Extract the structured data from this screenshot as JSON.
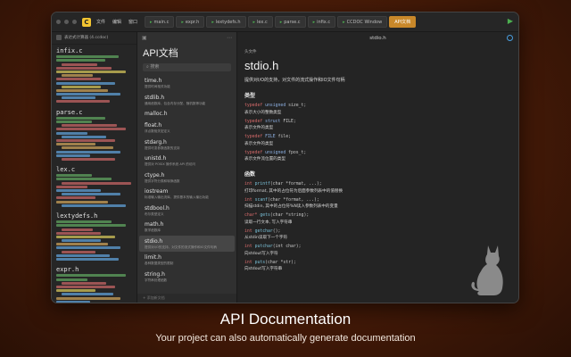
{
  "window": {
    "app_icon": "app-logo",
    "menu": [
      "文件",
      "编辑",
      "窗口",
      "工具"
    ],
    "tabs": [
      {
        "label": "main.c",
        "active": false
      },
      {
        "label": "expr.h",
        "active": false
      },
      {
        "label": "lextydefs.h",
        "active": false
      },
      {
        "label": "lex.c",
        "active": false
      },
      {
        "label": "parse.c",
        "active": false
      },
      {
        "label": "infix.c",
        "active": false
      },
      {
        "label": "CCDOC Window",
        "active": false
      },
      {
        "label": "API文档",
        "active": true
      }
    ]
  },
  "sidebar": {
    "header": "表达式计算器 (4.ccdoc)",
    "files": [
      {
        "name": "infix.c",
        "colors": [
          "#5fa35f",
          "#5fa35f",
          "#c46464",
          "#c46464",
          "#d2c35a",
          "#c9a05a",
          "#c46464",
          "#5f9fd5",
          "#d2c35a",
          "#c9a05a",
          "#5f9fd5",
          "#5f9fd5",
          "#c46464"
        ]
      },
      {
        "name": "parse.c",
        "colors": [
          "#5fa35f",
          "#5fa35f",
          "#c46464",
          "#c46464",
          "#5f9fd5",
          "#5f9fd5",
          "#c46464",
          "#c9a05a",
          "#c9a05a",
          "#5f9fd5",
          "#5f9fd5",
          "#c46464"
        ]
      },
      {
        "name": "lex.c",
        "colors": [
          "#5fa35f",
          "#5fa35f",
          "#c46464",
          "#c46464",
          "#5f9fd5",
          "#5f9fd5",
          "#c46464",
          "#c9a05a",
          "#5f9fd5"
        ]
      },
      {
        "name": "lextydefs.h",
        "colors": [
          "#5fa35f",
          "#5fa35f",
          "#c46464",
          "#c46464",
          "#d2c35a",
          "#5f9fd5",
          "#c9a05a",
          "#5f9fd5",
          "#c46464",
          "#5f9fd5",
          "#5f9fd5"
        ]
      },
      {
        "name": "expr.h",
        "colors": [
          "#5fa35f",
          "#5fa35f",
          "#c46464",
          "#c46464",
          "#d2c35a",
          "#5f9fd5",
          "#c9a05a",
          "#5f9fd5",
          "#5f9fd5",
          "#c46464",
          "#5f9fd5"
        ]
      },
      {
        "name": "main.c",
        "colors": [
          "#5fa35f",
          "#5fa35f",
          "#c46464"
        ]
      }
    ]
  },
  "docnav": {
    "title": "API文档",
    "search_placeholder": "搜索",
    "items": [
      {
        "title": "time.h",
        "desc": "提供时间相关功能",
        "selected": false
      },
      {
        "title": "stdlib.h",
        "desc": "通用函数库，包含内存分配、随机数等功能",
        "selected": false
      },
      {
        "title": "malloc.h",
        "desc": "",
        "selected": false
      },
      {
        "title": "float.h",
        "desc": "浮点数相关宏定义",
        "selected": false
      },
      {
        "title": "stdarg.h",
        "desc": "提供可变参数函数的支持",
        "selected": false
      },
      {
        "title": "unistd.h",
        "desc": "提供对 POSIX 操作系统 API 的访问",
        "selected": false
      },
      {
        "title": "ctype.h",
        "desc": "提供字符分类和转换函数",
        "selected": false
      },
      {
        "title": "iostream",
        "desc": "标准输入输出流库，提供基本的输入输出功能",
        "selected": false
      },
      {
        "title": "stdbool.h",
        "desc": "布尔类型定义",
        "selected": false
      },
      {
        "title": "math.h",
        "desc": "数学函数库",
        "selected": false
      },
      {
        "title": "stdio.h",
        "desc": "提供对I/O的支持，对文件的流式操作和IO文件句柄",
        "selected": true
      },
      {
        "title": "limit.h",
        "desc": "各种数据类型的限制",
        "selected": false
      },
      {
        "title": "string.h",
        "desc": "字符串处理函数",
        "selected": false
      }
    ],
    "bottom": "+ 添加新文档"
  },
  "content": {
    "window_title": "stdio.h",
    "header_label": "头文件",
    "heading": "stdio.h",
    "description": "提供对I/O的支持，对文件的流式操作和IO文件句柄",
    "types_title": "类型",
    "types": [
      {
        "kw": "typedef",
        "ty": "unsigned",
        "rest": "size_t;",
        "desc": "表示大小的整数类型"
      },
      {
        "kw": "typedef",
        "ty": "struct",
        "rest": "FILE;",
        "desc": "表示文件的类型"
      },
      {
        "kw": "typedef",
        "ty": "FILE",
        "rest": "file;",
        "desc": "表示文件的类型"
      },
      {
        "kw": "typedef",
        "ty": "unsigned",
        "rest": "fpos_t;",
        "desc": "表示文件流位置的类型"
      }
    ],
    "functions_title": "函数",
    "functions": [
      {
        "kw": "int",
        "fn": "printf",
        "rest": "(char *format, ...);",
        "desc": "打印format, 其中的占位符为后面参数列表中的值替换"
      },
      {
        "kw": "int",
        "fn": "scanf",
        "rest": "(char *format, ...);",
        "desc": "扫描stdin, 其中的占位符%N读入参数列表中的变量"
      },
      {
        "kw": "char*",
        "fn": "gets",
        "rest": "(char *string);",
        "desc": "读取一行文本, 写入字符串"
      },
      {
        "kw": "int",
        "fn": "getchar",
        "rest": "();",
        "desc": "从stdin读取下一个字符"
      },
      {
        "kw": "int",
        "fn": "putchar",
        "rest": "(int char);",
        "desc": "向stdout写入字符"
      },
      {
        "kw": "int",
        "fn": "puts",
        "rest": "(char *str);",
        "desc": "向stdout写入字符串"
      }
    ]
  },
  "caption": {
    "title": "API Documentation",
    "subtitle": "Your project can also automatically generate documentation"
  }
}
